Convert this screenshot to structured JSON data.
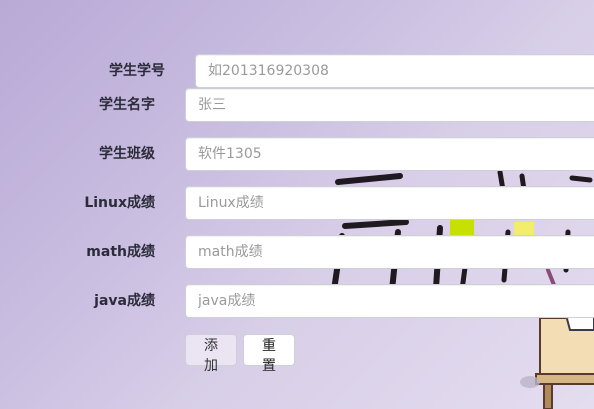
{
  "form": {
    "fields": [
      {
        "label": "学生学号",
        "placeholder": "如201316920308",
        "value": ""
      },
      {
        "label": "学生名字",
        "placeholder": "张三",
        "value": ""
      },
      {
        "label": "学生班级",
        "placeholder": "软件1305",
        "value": ""
      },
      {
        "label": "Linux成绩",
        "placeholder": "Linux成绩",
        "value": ""
      },
      {
        "label": "math成绩",
        "placeholder": "math成绩",
        "value": ""
      },
      {
        "label": "java成绩",
        "placeholder": "java成绩",
        "value": ""
      }
    ],
    "buttons": {
      "add_label": "添加",
      "reset_label": "重置"
    }
  },
  "colors": {
    "background_start": "#b8a9d6",
    "background_end": "#e4dcef",
    "field_border": "#cfcfd6",
    "label_text": "#2b2b3a"
  }
}
